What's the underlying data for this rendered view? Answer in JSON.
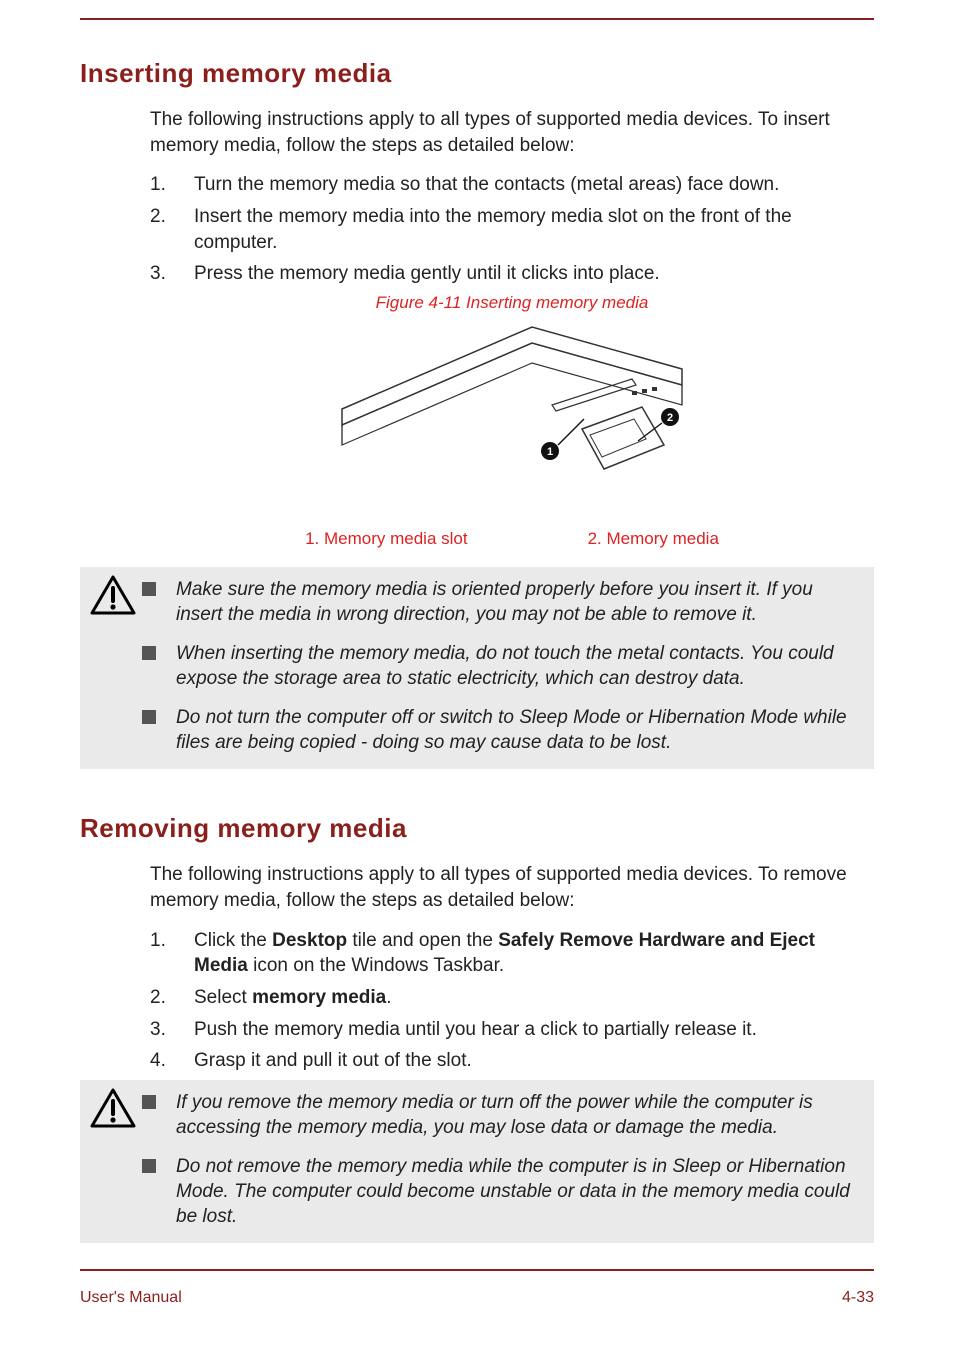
{
  "section1": {
    "title": "Inserting memory media",
    "intro": "The following instructions apply to all types of supported media devices. To insert memory media, follow the steps as detailed below:",
    "steps": [
      {
        "n": "1.",
        "text": "Turn the memory media so that the contacts (metal areas) face down."
      },
      {
        "n": "2.",
        "text": "Insert the memory media into the memory media slot on the front of the computer."
      },
      {
        "n": "3.",
        "text": "Press the memory media gently until it clicks into place."
      }
    ],
    "figure_caption": "Figure 4-11 Inserting memory media",
    "legend": {
      "item1": "1. Memory media slot",
      "item2": "2. Memory media"
    },
    "warnings": [
      "Make sure the memory media is oriented properly before you insert it. If you insert the media in wrong direction, you may not be able to remove it.",
      "When inserting the memory media, do not touch the metal contacts. You could expose the storage area to static electricity, which can destroy data.",
      "Do not turn the computer off or switch to Sleep Mode or Hibernation Mode while files are being copied - doing so may cause data to be lost."
    ]
  },
  "section2": {
    "title": "Removing memory media",
    "intro": "The following instructions apply to all types of supported media devices. To remove memory media, follow the steps as detailed below:",
    "steps": [
      {
        "n": "1.",
        "pre": "Click the ",
        "b1": "Desktop",
        "mid": " tile and open the ",
        "b2": "Safely Remove Hardware and Eject Media",
        "post": " icon on the Windows Taskbar."
      },
      {
        "n": "2.",
        "pre": "Select ",
        "b1": "memory media",
        "mid": "",
        "b2": "",
        "post": "."
      },
      {
        "n": "3.",
        "plain": "Push the memory media until you hear a click to partially release it."
      },
      {
        "n": "4.",
        "plain": "Grasp it and pull it out of the slot."
      }
    ],
    "warnings": [
      "If you remove the memory media or turn off the power while the computer is accessing the memory media, you may lose data or damage the media.",
      "Do not remove the memory media while the computer is in Sleep or Hibernation Mode. The computer could become unstable or data in the memory media could be lost."
    ]
  },
  "footer": {
    "left": "User's Manual",
    "right": "4-33"
  }
}
